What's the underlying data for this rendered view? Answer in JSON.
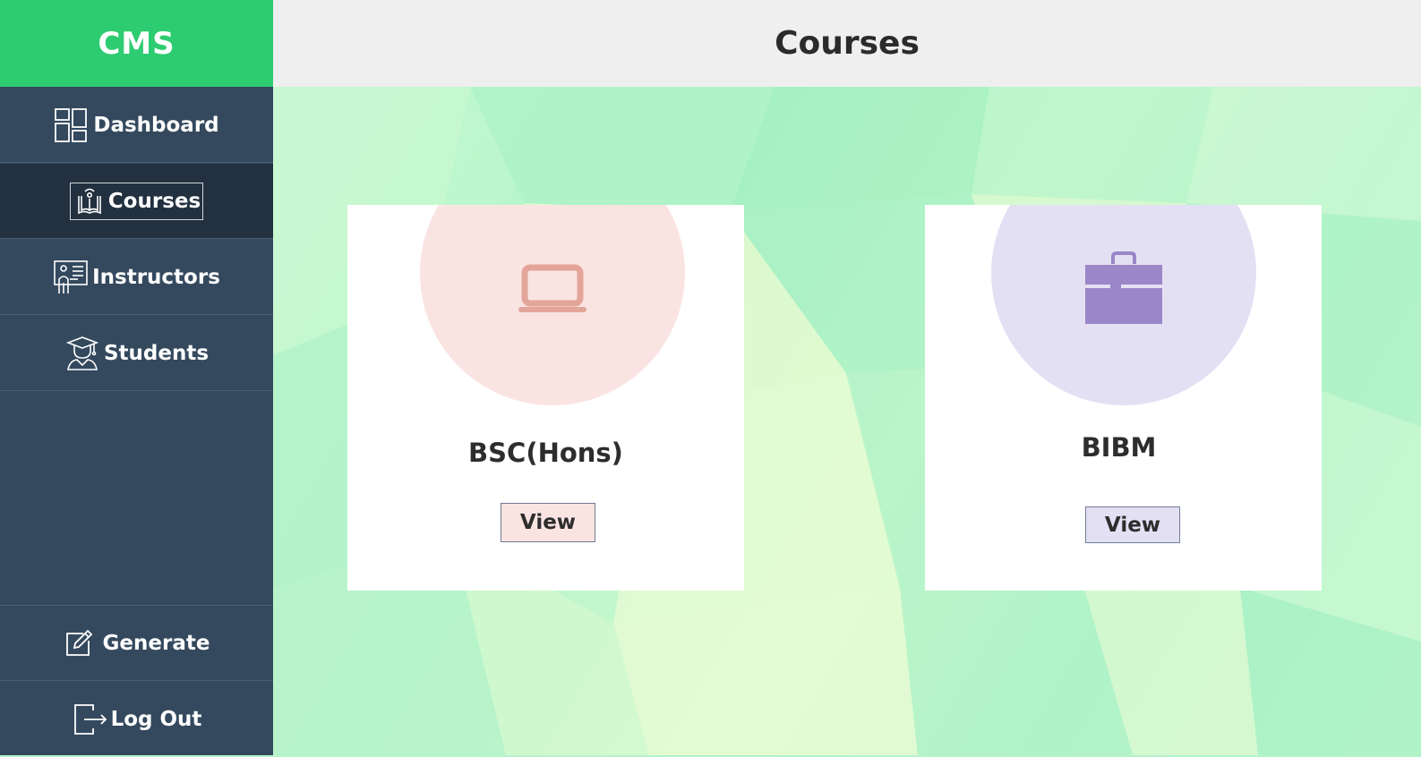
{
  "app": {
    "brand": "CMS",
    "page_title": "Courses"
  },
  "sidebar": {
    "items": [
      {
        "label": "Dashboard",
        "icon": "dashboard-icon"
      },
      {
        "label": "Courses",
        "icon": "book-icon",
        "active": true
      },
      {
        "label": "Instructors",
        "icon": "instructor-icon"
      },
      {
        "label": "Students",
        "icon": "student-icon"
      }
    ],
    "bottom_items": [
      {
        "label": "Generate",
        "icon": "edit-icon"
      },
      {
        "label": "Log Out",
        "icon": "logout-icon"
      }
    ]
  },
  "courses": [
    {
      "name": "BSC(Hons)",
      "button": "View",
      "icon": "laptop-icon",
      "circle_color": "#fae4e2",
      "icon_color": "#e3a59a",
      "button_color": "#fae4e2"
    },
    {
      "name": "BIBM",
      "button": "View",
      "icon": "briefcase-icon",
      "circle_color": "#e4e0f4",
      "icon_color": "#9b86c8",
      "button_color": "#e4e0f4"
    }
  ],
  "colors": {
    "brand": "#2ecc71",
    "sidebar": "#34495e",
    "sidebar_active": "#22303f",
    "header": "#efefef",
    "background": "#b5f3c9"
  }
}
